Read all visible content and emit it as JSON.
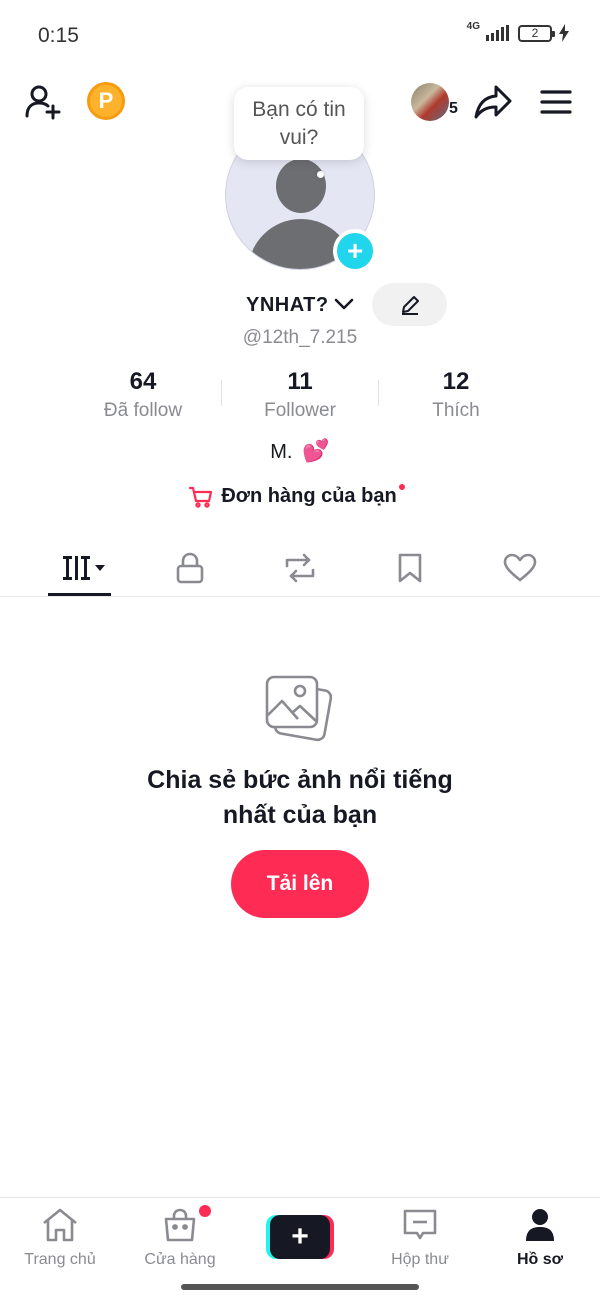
{
  "status_bar": {
    "time": "0:15",
    "network": "4G",
    "battery": "2"
  },
  "header": {
    "coin_letter": "P",
    "friends_count": "5"
  },
  "profile": {
    "bubble_text": "Bạn có tin vui?",
    "username": "YNHAT?",
    "handle": "@12th_7.215",
    "bio": "M.",
    "bio_emoji": "💕"
  },
  "stats": [
    {
      "value": "64",
      "label": "Đã follow"
    },
    {
      "value": "11",
      "label": "Follower"
    },
    {
      "value": "12",
      "label": "Thích"
    }
  ],
  "orders_label": "Đơn hàng của bạn",
  "tabs": [
    "videos-grid",
    "private-lock",
    "repost",
    "bookmark",
    "liked-heart"
  ],
  "empty_state": {
    "title_line1": "Chia sẻ bức ảnh nổi tiếng",
    "title_line2": "nhất của bạn",
    "upload_label": "Tải lên"
  },
  "bottom_nav": [
    {
      "label": "Trang chủ",
      "icon": "home-icon"
    },
    {
      "label": "Cửa hàng",
      "icon": "shop-bag-icon"
    },
    {
      "label": "",
      "icon": "create-plus-icon"
    },
    {
      "label": "Hộp thư",
      "icon": "inbox-icon"
    },
    {
      "label": "Hồ sơ",
      "icon": "profile-icon"
    }
  ],
  "colors": {
    "accent": "#fe2c55",
    "cyan": "#25f4ee",
    "add_badge": "#20d5ec",
    "coin": "#fcb22a"
  }
}
